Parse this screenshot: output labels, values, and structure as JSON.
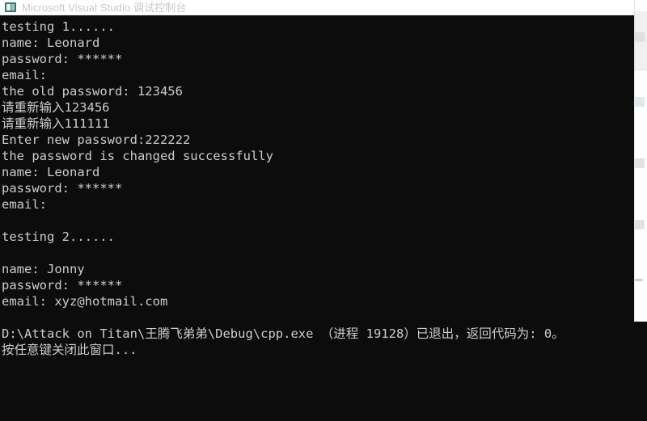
{
  "window": {
    "title": "Microsoft Visual Studio 调试控制台",
    "icon": "console-icon",
    "background_color": "#0c0c0c",
    "titlebar_color": "#ffffff",
    "text_color": "#cccccc"
  },
  "console": {
    "lines": [
      "testing 1......",
      "name: Leonard",
      "password: ******",
      "email:",
      "the old password: 123456",
      "请重新输入123456",
      "请重新输入111111",
      "Enter new password:222222",
      "the password is changed successfully",
      "name: Leonard",
      "password: ******",
      "email:",
      "",
      "testing 2......",
      "",
      "name: Jonny",
      "password: ******",
      "email: xyz@hotmail.com",
      "",
      "D:\\Attack on Titan\\王腾飞弟弟\\Debug\\cpp.exe （进程 19128）已退出，返回代码为: 0。",
      "按任意键关闭此窗口..."
    ]
  },
  "background_app": {
    "visible_strip": true,
    "panel_color": "#ffffff",
    "toolstrip_color": "#f0f0f0"
  }
}
